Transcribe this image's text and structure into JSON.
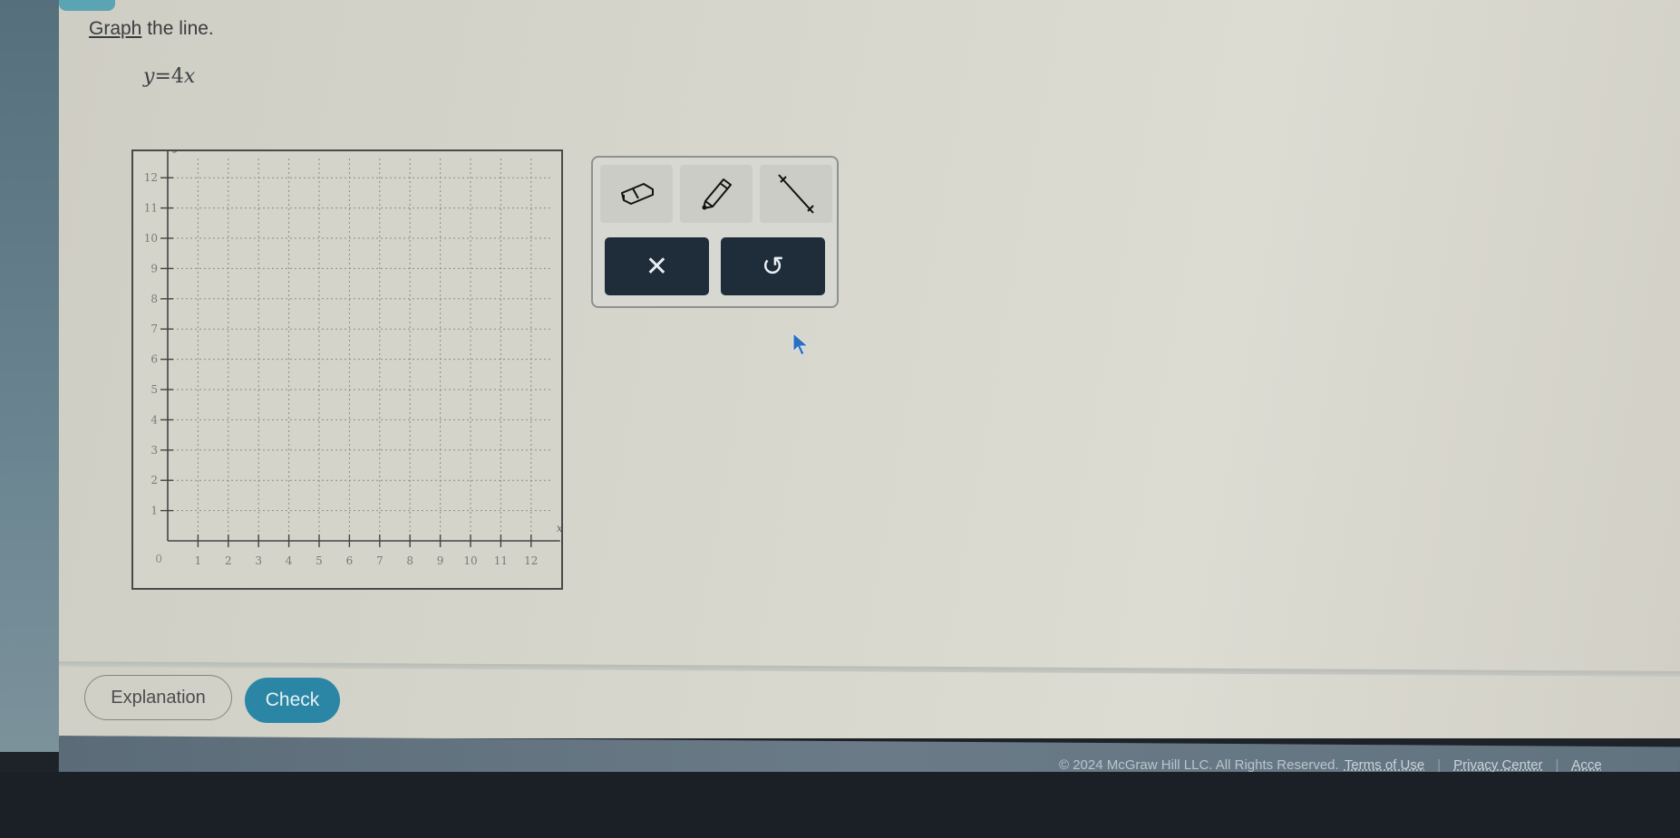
{
  "question": {
    "prompt_link": "Graph",
    "prompt_rest": " the line.",
    "equation": {
      "lhs": "y",
      "op": "=",
      "coef": "4",
      "var": "x"
    }
  },
  "toolbar": {
    "tools": [
      {
        "name": "eraser",
        "icon": "eraser-icon"
      },
      {
        "name": "pencil",
        "icon": "pencil-icon"
      },
      {
        "name": "line",
        "icon": "line-tool-icon"
      }
    ],
    "actions": [
      {
        "name": "clear",
        "icon": "x-icon",
        "glyph": "✕"
      },
      {
        "name": "undo",
        "icon": "undo-icon",
        "glyph": "↺"
      }
    ]
  },
  "buttons": {
    "explanation": "Explanation",
    "check": "Check"
  },
  "footer": {
    "copyright": "© 2024 McGraw Hill LLC. All Rights Reserved.",
    "links": [
      "Terms of Use",
      "Privacy Center",
      "Acce"
    ]
  },
  "chart_data": {
    "type": "line",
    "title": "",
    "xlabel": "x",
    "ylabel": "y",
    "xlim": [
      0,
      12
    ],
    "ylim": [
      0,
      12
    ],
    "x_ticks": [
      "1",
      "2",
      "3",
      "4",
      "5",
      "6",
      "7",
      "8",
      "9",
      "10",
      "11",
      "12"
    ],
    "y_ticks": [
      "1",
      "2",
      "3",
      "4",
      "5",
      "6",
      "7",
      "8",
      "9",
      "10",
      "11",
      "12"
    ],
    "origin_label": "0",
    "grid": true,
    "series": []
  },
  "colors": {
    "check_button": "#2b86a5",
    "action_button": "#1f2d3b",
    "footer": "#627380"
  }
}
